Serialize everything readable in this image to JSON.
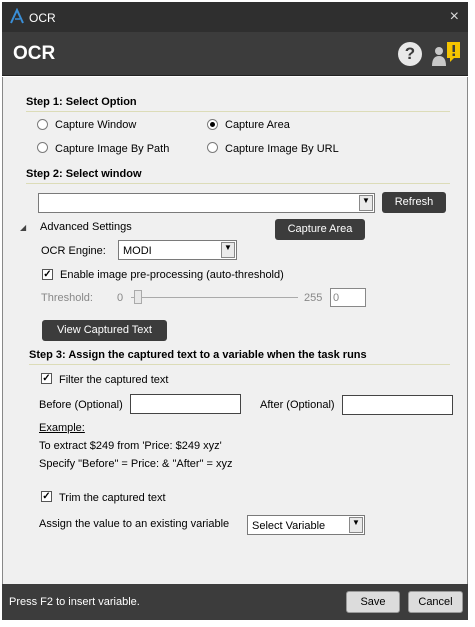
{
  "window": {
    "title": "OCR",
    "close_glyph": "×"
  },
  "header": {
    "title": "OCR",
    "help_glyph": "?"
  },
  "step1": {
    "heading": "Step 1: Select Option",
    "options": [
      {
        "label": "Capture Window",
        "selected": false
      },
      {
        "label": "Capture Area",
        "selected": true
      },
      {
        "label": "Capture Image By Path",
        "selected": false
      },
      {
        "label": "Capture Image By URL",
        "selected": false
      }
    ]
  },
  "step2": {
    "heading": "Step 2: Select window",
    "window_value": "",
    "refresh_label": "Refresh",
    "advanced_label": "Advanced Settings",
    "capture_area_label": "Capture Area",
    "ocr_engine_label": "OCR Engine:",
    "ocr_engine_value": "MODI",
    "preprocess_label": "Enable image pre-processing (auto-threshold)",
    "preprocess_checked": true,
    "threshold_label": "Threshold:",
    "threshold_min": "0",
    "threshold_max": "255",
    "threshold_value": "0",
    "view_captured_label": "View Captured Text"
  },
  "step3": {
    "heading": "Step 3: Assign the captured text to a variable when the task runs",
    "filter_label": "Filter the captured text",
    "filter_checked": true,
    "before_label": "Before (Optional)",
    "before_value": "",
    "after_label": "After (Optional)",
    "after_value": "",
    "example_heading": "Example:",
    "example_line1": "To extract $249 from 'Price: $249 xyz'",
    "example_line2": "Specify \"Before\" = Price: & \"After\" = xyz",
    "trim_label": "Trim the captured text",
    "trim_checked": true,
    "assign_label": "Assign the value to an existing variable",
    "variable_value": "Select Variable"
  },
  "footer": {
    "hint": "Press F2 to insert variable.",
    "save_label": "Save",
    "cancel_label": "Cancel"
  },
  "colors": {
    "chrome": "#3c3c3c",
    "panel": "#f0f0f0",
    "accent": "#3a8fd8",
    "notify": "#f5c400"
  },
  "icons": {
    "logo": "a-logo-icon",
    "close": "close-icon",
    "help": "help-icon",
    "notifications": "user-notification-icon",
    "check": "check-icon",
    "dropdown": "chevron-down-icon",
    "expander": "triangle-expander-icon"
  }
}
